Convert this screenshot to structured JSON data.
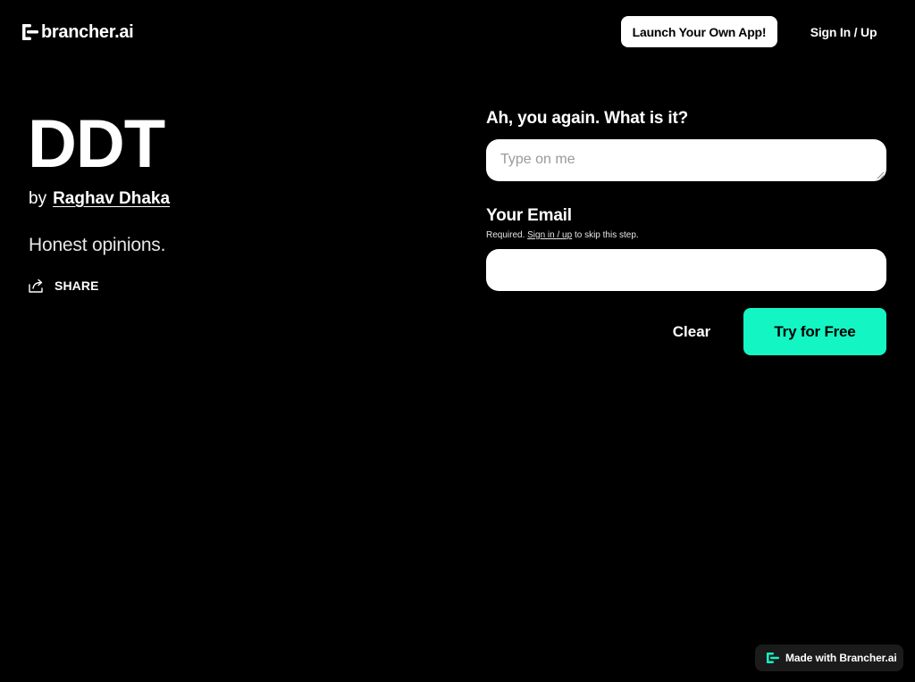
{
  "header": {
    "logo_text": "brancher.ai",
    "launch_button": "Launch Your Own App!",
    "sign_in": "Sign In / Up"
  },
  "app": {
    "title": "DDT",
    "by_label": "by",
    "author": "Raghav Dhaka",
    "tagline": "Honest opinions.",
    "share_label": "SHARE"
  },
  "form": {
    "question_label": "Ah, you again. What is it?",
    "prompt_placeholder": "Type on me",
    "prompt_value": "",
    "email_label": "Your Email",
    "email_note_prefix": "Required.",
    "email_note_link": "Sign in / up",
    "email_note_suffix": "to skip this step.",
    "email_value": "",
    "clear_button": "Clear",
    "submit_button": "Try for Free"
  },
  "footer": {
    "made_with": "Made with Brancher.ai"
  },
  "colors": {
    "background": "#000000",
    "accent": "#14f5c4",
    "input_bg": "#ffffff",
    "badge_bg": "#1b1b1b"
  },
  "icons": {
    "logo": "brancher-logo-icon",
    "share": "share-icon",
    "badge": "brancher-mini-logo-icon"
  }
}
